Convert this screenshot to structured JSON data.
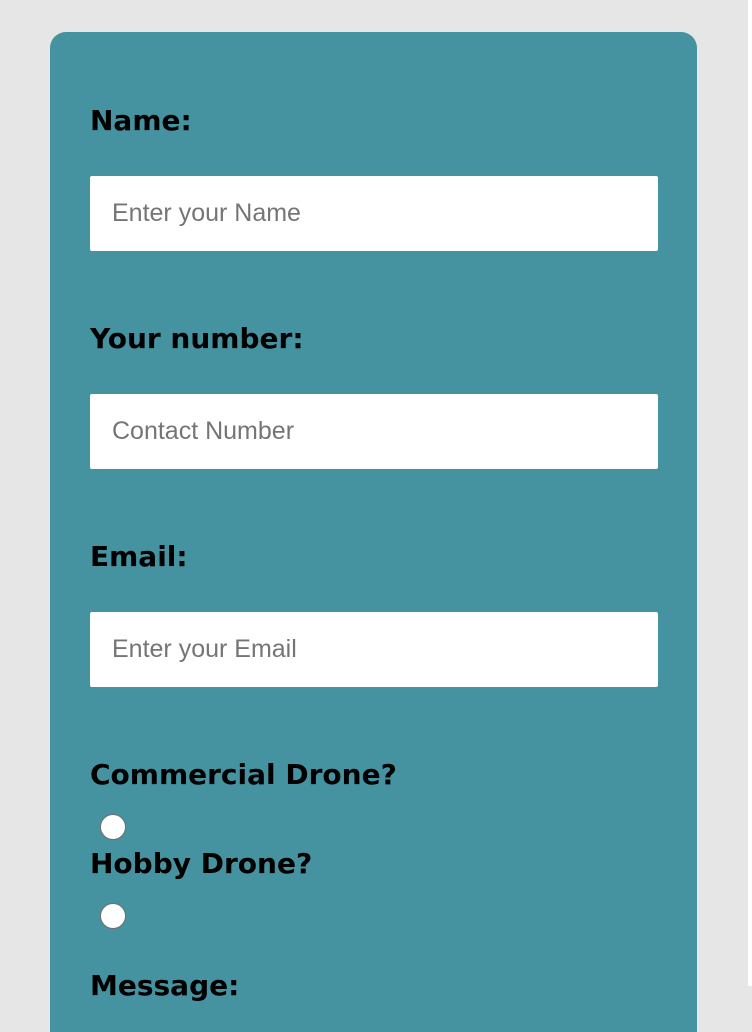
{
  "form": {
    "name": {
      "label": "Name:",
      "placeholder": "Enter your Name",
      "value": ""
    },
    "number": {
      "label": "Your number:",
      "placeholder": "Contact Number",
      "value": ""
    },
    "email": {
      "label": "Email:",
      "placeholder": "Enter your Email",
      "value": ""
    },
    "commercial": {
      "label": "Commercial Drone?"
    },
    "hobby": {
      "label": "Hobby Drone?"
    },
    "message": {
      "label": "Message:"
    }
  },
  "colors": {
    "page_background": "#e6e6e6",
    "card_background": "#4592a0",
    "input_background": "#ffffff",
    "placeholder_text": "#757575",
    "label_text": "#000000"
  }
}
